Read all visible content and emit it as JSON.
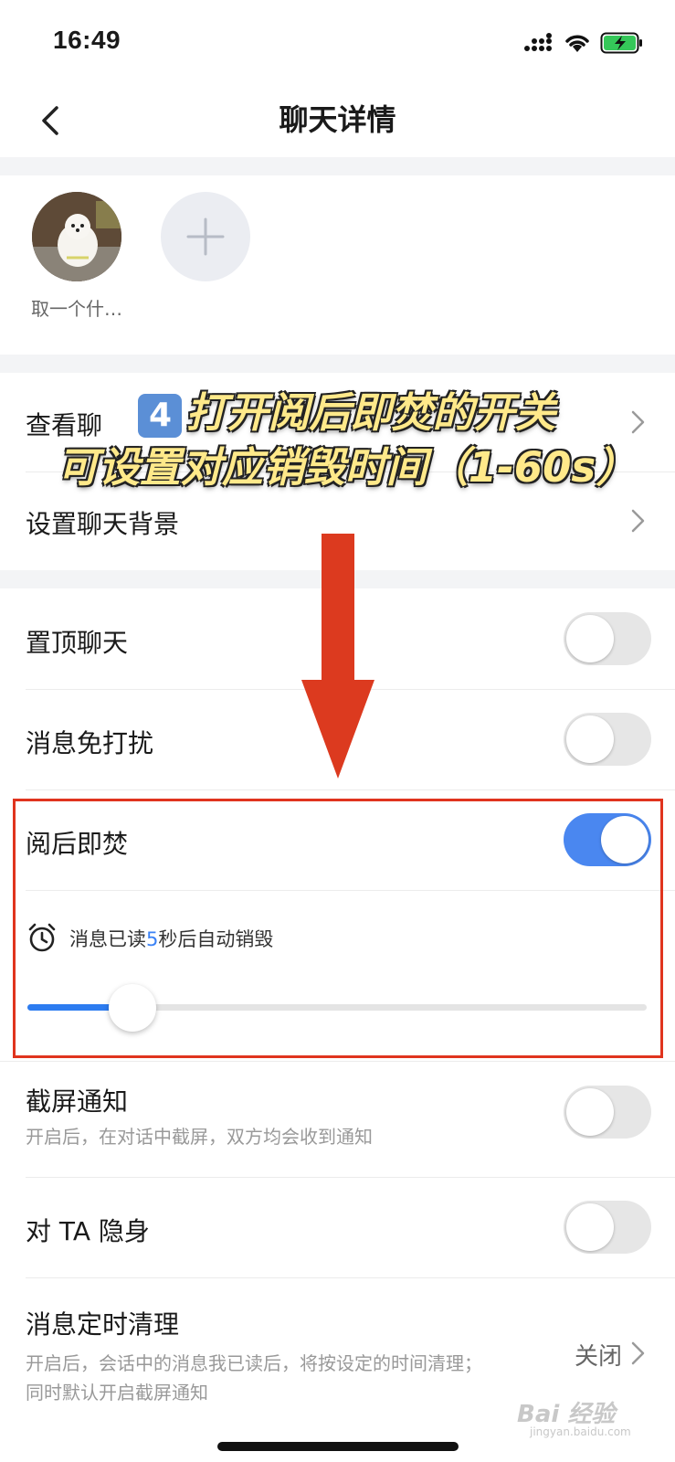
{
  "status_bar": {
    "time": "16:49"
  },
  "header": {
    "title": "聊天详情"
  },
  "members": {
    "avatar_name": "取一个什…"
  },
  "settings": {
    "view_chat": "查看聊",
    "set_background": "设置聊天背景",
    "pin_chat": "置顶聊天",
    "mute": "消息免打扰",
    "burn_after_read": "阅后即焚",
    "timer_prefix": "消息已读",
    "timer_value": "5",
    "timer_suffix": "秒后自动销毁",
    "screenshot_notify": "截屏通知",
    "screenshot_notify_desc": "开启后，在对话中截屏，双方均会收到通知",
    "hide_from_ta": "对 TA 隐身",
    "auto_clean": "消息定时清理",
    "auto_clean_desc": "开启后，会话中的消息我已读后，将按设定的时间清理；",
    "auto_clean_desc2": "同时默认开启截屏通知",
    "auto_clean_value": "关闭"
  },
  "toggles": {
    "pin_chat": false,
    "mute": false,
    "burn_after_read": true,
    "screenshot_notify": false,
    "hide_from_ta": false
  },
  "slider": {
    "min": 1,
    "max": 60,
    "value": 5
  },
  "annotation": {
    "badge": "4",
    "line1": "打开阅后即焚的开关",
    "line2": "可设置对应销毁时间（1-60s）"
  },
  "watermark": {
    "main": "Bai 经验",
    "sub": "jingyan.baidu.com"
  },
  "colors": {
    "accent": "#4a87f0",
    "highlight": "#e0341e",
    "arrow": "#dc3a1f",
    "caption": "#ffe98a"
  }
}
